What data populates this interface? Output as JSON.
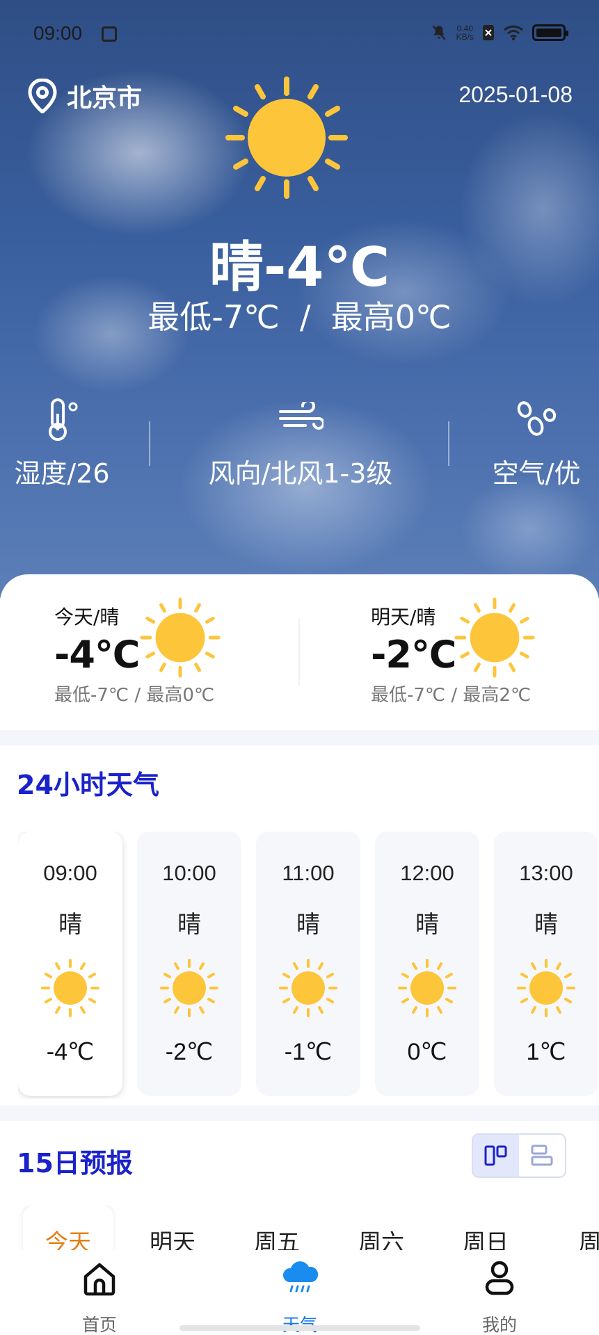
{
  "status_bar": {
    "time": "09:00",
    "net_speed_value": "0.40",
    "net_speed_unit": "KB/s"
  },
  "header": {
    "location": "北京市",
    "date": "2025-01-08"
  },
  "current": {
    "summary": "晴-4℃",
    "range": "最低-7℃  /  最高0℃"
  },
  "metrics": {
    "humidity": "湿度/26",
    "wind": "风向/北风1-3级",
    "air": "空气/优"
  },
  "today": {
    "head": "今天/晴",
    "temp": "-4℃",
    "range": "最低-7℃ / 最高0℃"
  },
  "tomorrow": {
    "head": "明天/晴",
    "temp": "-2℃",
    "range": "最低-7℃ / 最高2℃"
  },
  "hourly": {
    "title": "24小时天气",
    "items": [
      {
        "time": "09:00",
        "cond": "晴",
        "temp": "-4℃"
      },
      {
        "time": "10:00",
        "cond": "晴",
        "temp": "-2℃"
      },
      {
        "time": "11:00",
        "cond": "晴",
        "temp": "-1℃"
      },
      {
        "time": "12:00",
        "cond": "晴",
        "temp": "0℃"
      },
      {
        "time": "13:00",
        "cond": "晴",
        "temp": "1℃"
      }
    ]
  },
  "forecast15": {
    "title": "15日预报",
    "tabs": [
      "今天",
      "明天",
      "周五",
      "周六",
      "周日",
      "周"
    ]
  },
  "nav": {
    "home": "首页",
    "weather": "天气",
    "mine": "我的"
  },
  "colors": {
    "accent_blue": "#1a22c9",
    "sun": "#fcc53a",
    "nav_active": "#1576e6",
    "tab_active": "#e67e13"
  }
}
